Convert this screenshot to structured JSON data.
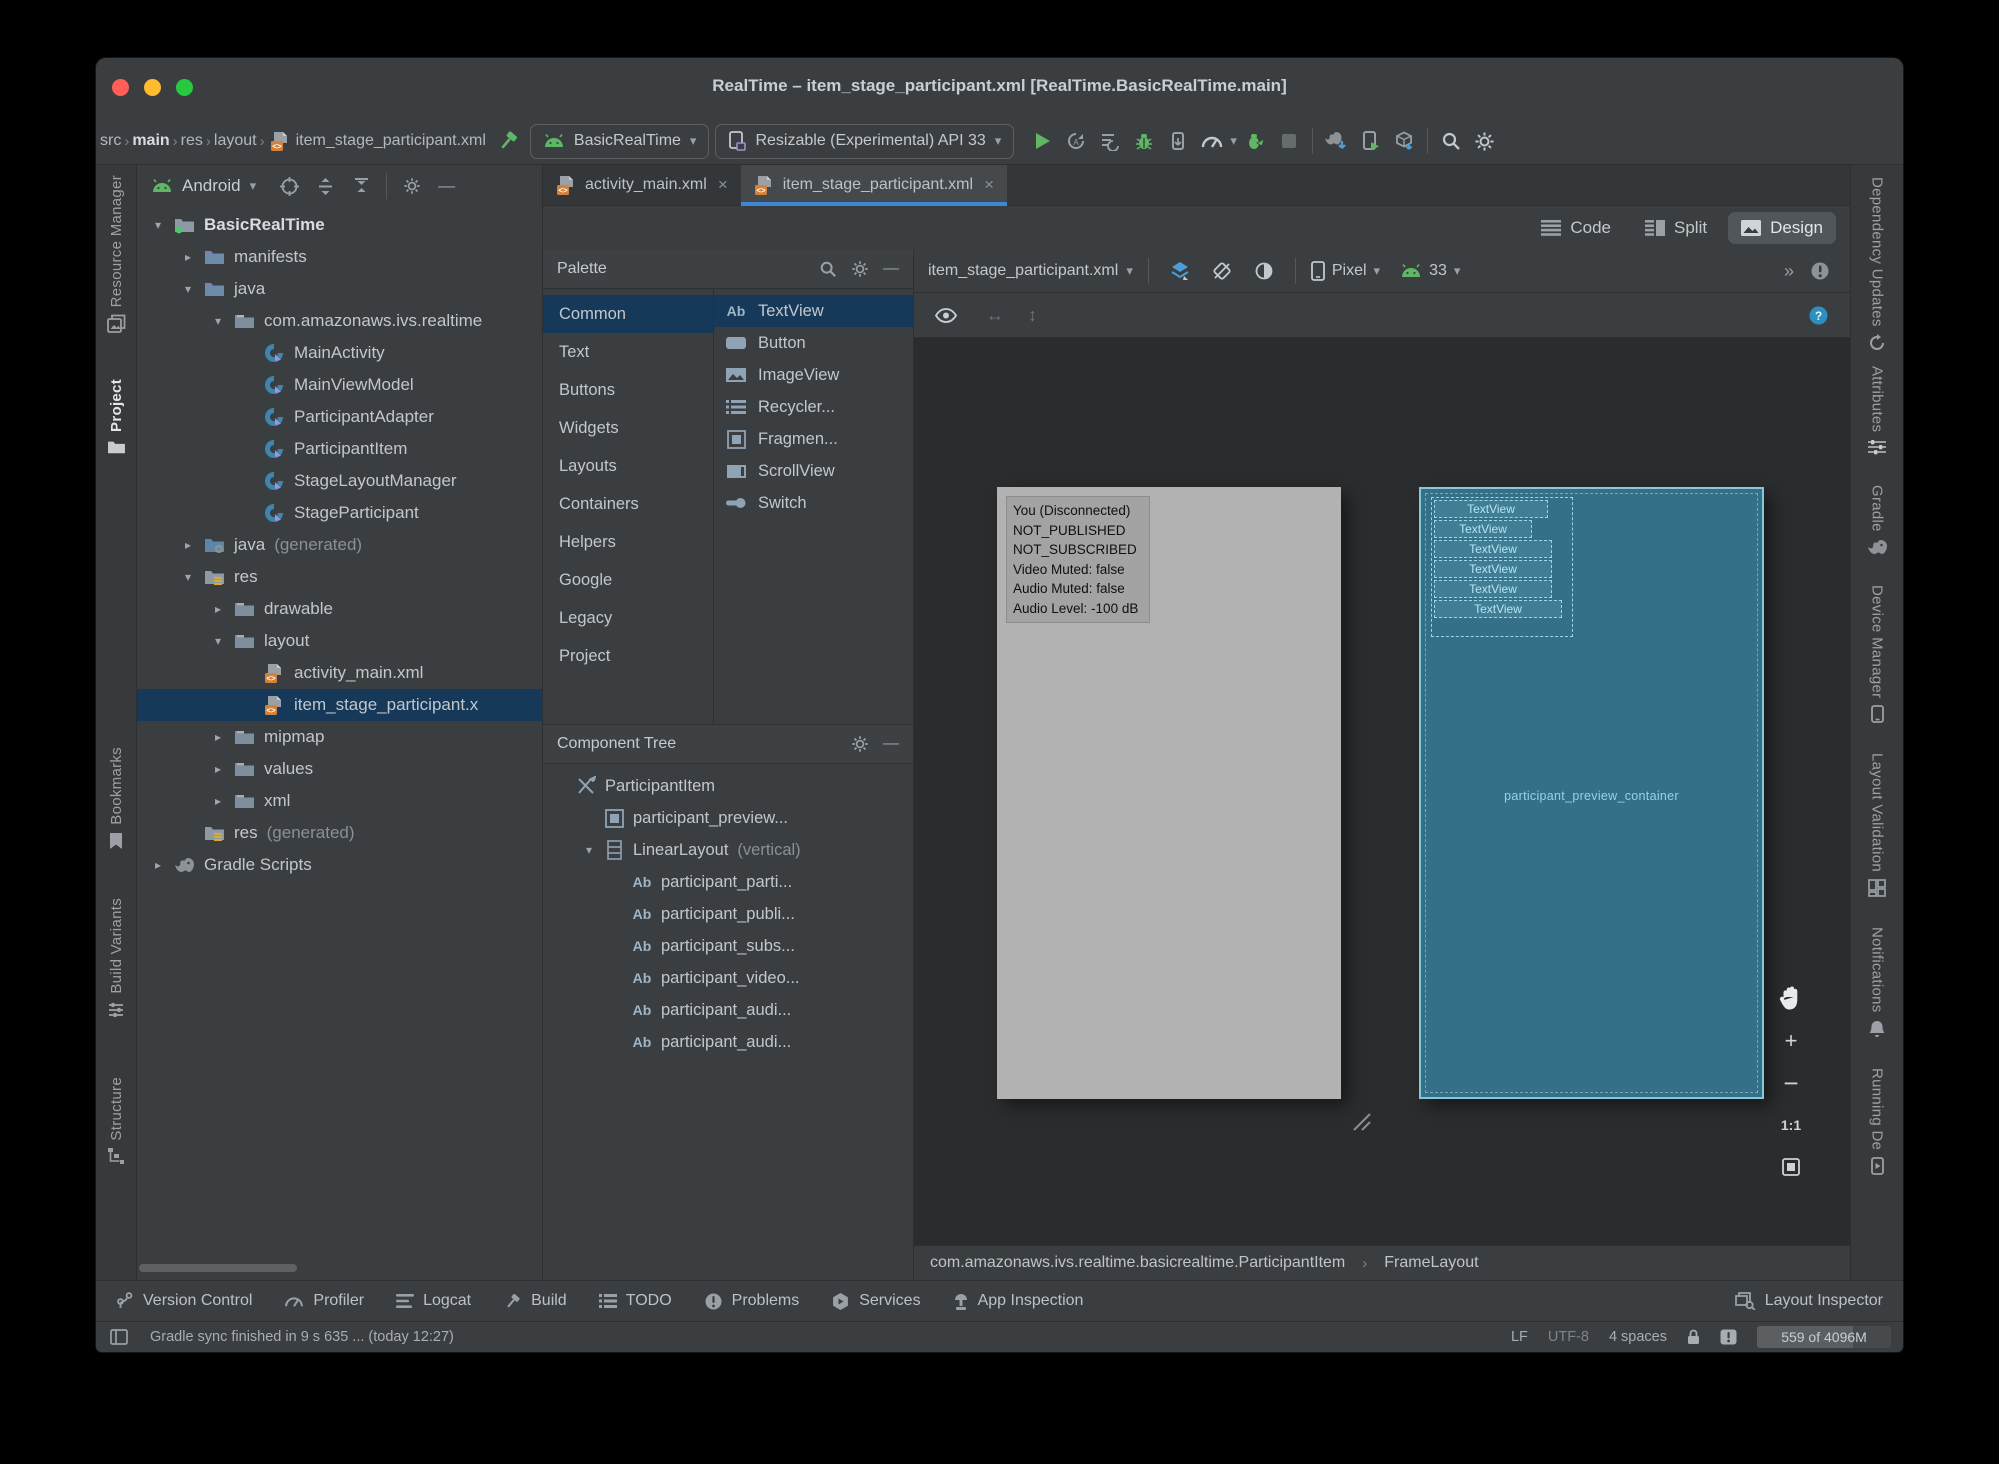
{
  "window": {
    "title": "RealTime – item_stage_participant.xml [RealTime.BasicRealTime.main]"
  },
  "toolbar": {
    "breadcrumbs": [
      "src",
      "main",
      "res",
      "layout",
      "item_stage_participant.xml"
    ],
    "run_config": "BasicRealTime",
    "device_select": "Resizable (Experimental) API 33",
    "actions": [
      "run",
      "apply-changes",
      "apply-code-changes",
      "debug",
      "attach-debugger",
      "profiler",
      "profile-app",
      "stop",
      "sync-gradle",
      "device-manager",
      "sdk-manager",
      "search-everywhere",
      "settings"
    ]
  },
  "stripes": {
    "left": [
      {
        "label": "Resource Manager",
        "icon": "resource-manager",
        "active": false
      },
      {
        "label": "Project",
        "icon": "project-folder",
        "active": true
      },
      {
        "label": "Bookmarks",
        "icon": "bookmark",
        "active": false
      },
      {
        "label": "Build Variants",
        "icon": "build-variants",
        "active": false
      },
      {
        "label": "Structure",
        "icon": "structure",
        "active": false
      }
    ],
    "right": [
      {
        "label": "Dependency Updates",
        "icon": "dependency-updates",
        "active": false
      },
      {
        "label": "Attributes",
        "icon": "attributes",
        "active": false
      },
      {
        "label": "Gradle",
        "icon": "gradle",
        "active": false
      },
      {
        "label": "Device Manager",
        "icon": "device-phone",
        "active": false
      },
      {
        "label": "Layout Validation",
        "icon": "layout-validation",
        "active": false
      },
      {
        "label": "Notifications",
        "icon": "notifications",
        "active": false
      },
      {
        "label": "Running De",
        "icon": "running-devices",
        "active": false
      }
    ]
  },
  "project": {
    "view_mode": "Android",
    "tree": [
      {
        "label": "BasicRealTime",
        "icon": "folder-root",
        "level": 0,
        "chevron": "down",
        "bold": true
      },
      {
        "label": "manifests",
        "icon": "folder-blue",
        "level": 1,
        "chevron": "right"
      },
      {
        "label": "java",
        "icon": "folder-blue",
        "level": 1,
        "chevron": "down"
      },
      {
        "label": "com.amazonaws.ivs.realtime",
        "icon": "folder-package",
        "level": 2,
        "chevron": "down"
      },
      {
        "label": "MainActivity",
        "icon": "class-kotlin",
        "level": 3
      },
      {
        "label": "MainViewModel",
        "icon": "class-kotlin",
        "level": 3
      },
      {
        "label": "ParticipantAdapter",
        "icon": "class-kotlin",
        "level": 3
      },
      {
        "label": "ParticipantItem",
        "icon": "class-kotlin",
        "level": 3
      },
      {
        "label": "StageLayoutManager",
        "icon": "class-kotlin",
        "level": 3
      },
      {
        "label": "StageParticipant",
        "icon": "class-kotlin",
        "level": 3
      },
      {
        "label": "java",
        "extra": "(generated)",
        "icon": "folder-generated",
        "level": 1,
        "chevron": "right"
      },
      {
        "label": "res",
        "icon": "folder-res",
        "level": 1,
        "chevron": "down"
      },
      {
        "label": "drawable",
        "icon": "folder-gray",
        "level": 2,
        "chevron": "right"
      },
      {
        "label": "layout",
        "icon": "folder-gray",
        "level": 2,
        "chevron": "down"
      },
      {
        "label": "activity_main.xml",
        "icon": "file-xml",
        "level": 3
      },
      {
        "label": "item_stage_participant.x",
        "icon": "file-xml",
        "level": 3,
        "selected": true
      },
      {
        "label": "mipmap",
        "icon": "folder-gray",
        "level": 2,
        "chevron": "right"
      },
      {
        "label": "values",
        "icon": "folder-gray",
        "level": 2,
        "chevron": "right"
      },
      {
        "label": "xml",
        "icon": "folder-gray",
        "level": 2,
        "chevron": "right"
      },
      {
        "label": "res",
        "extra": "(generated)",
        "icon": "folder-res",
        "level": 1
      },
      {
        "label": "Gradle Scripts",
        "icon": "gradle",
        "level": 0,
        "chevron": "right"
      }
    ]
  },
  "tabs": [
    {
      "label": "activity_main.xml",
      "icon": "file-xml",
      "active": false
    },
    {
      "label": "item_stage_participant.xml",
      "icon": "file-xml",
      "active": true
    }
  ],
  "editor_modes": {
    "code": "Code",
    "split": "Split",
    "design": "Design",
    "active": "Design"
  },
  "palette": {
    "title": "Palette",
    "categories": [
      "Common",
      "Text",
      "Buttons",
      "Widgets",
      "Layouts",
      "Containers",
      "Helpers",
      "Google",
      "Legacy",
      "Project"
    ],
    "selected_category": "Common",
    "items": [
      {
        "label": "TextView",
        "icon": "w-textview",
        "selected": true
      },
      {
        "label": "Button",
        "icon": "w-button",
        "selected": false
      },
      {
        "label": "ImageView",
        "icon": "w-imageview",
        "selected": false
      },
      {
        "label": "Recycler...",
        "icon": "w-recycler",
        "selected": false
      },
      {
        "label": "Fragmen...",
        "icon": "w-fragment",
        "selected": false
      },
      {
        "label": "ScrollView",
        "icon": "w-scrollview",
        "selected": false
      },
      {
        "label": "Switch",
        "icon": "w-switch",
        "selected": false
      }
    ]
  },
  "component_tree": {
    "title": "Component Tree",
    "rows": [
      {
        "label": "ParticipantItem",
        "icon": "custom-view",
        "level": 0
      },
      {
        "label": "participant_preview...",
        "icon": "w-fragment",
        "level": 1
      },
      {
        "label": "LinearLayout",
        "extra": "(vertical)",
        "icon": "linear-layout",
        "level": 1,
        "chevron": "down"
      },
      {
        "label": "participant_parti...",
        "icon": "w-textview",
        "level": 2
      },
      {
        "label": "participant_publi...",
        "icon": "w-textview",
        "level": 2
      },
      {
        "label": "participant_subs...",
        "icon": "w-textview",
        "level": 2
      },
      {
        "label": "participant_video...",
        "icon": "w-textview",
        "level": 2
      },
      {
        "label": "participant_audi...",
        "icon": "w-textview",
        "level": 2
      },
      {
        "label": "participant_audi...",
        "icon": "w-textview",
        "level": 2
      }
    ]
  },
  "design": {
    "file_dropdown": "item_stage_participant.xml",
    "device": "Pixel",
    "api": "33",
    "zoom_ratio": "1:1",
    "preview_info_lines": [
      "You (Disconnected)",
      "NOT_PUBLISHED",
      "NOT_SUBSCRIBED",
      "Video Muted: false",
      "Audio Muted: false",
      "Audio Level: -100 dB"
    ],
    "blueprint": {
      "textviews": [
        "TextView",
        "TextView",
        "TextView",
        "TextView",
        "TextView",
        "TextView"
      ],
      "container_label": "participant_preview_container"
    },
    "breadcrumb_class": "com.amazonaws.ivs.realtime.basicrealtime.ParticipantItem",
    "breadcrumb_layout": "FrameLayout"
  },
  "bottom_bar": {
    "left": [
      {
        "label": "Version Control",
        "icon": "vcs"
      },
      {
        "label": "Profiler",
        "icon": "gauge"
      },
      {
        "label": "Logcat",
        "icon": "logcat"
      },
      {
        "label": "Build",
        "icon": "hammer-gray"
      },
      {
        "label": "TODO",
        "icon": "todo"
      },
      {
        "label": "Problems",
        "icon": "problems"
      },
      {
        "label": "Services",
        "icon": "services"
      },
      {
        "label": "App Inspection",
        "icon": "inspection"
      }
    ],
    "right": [
      {
        "label": "Layout Inspector",
        "icon": "layout-inspector"
      }
    ]
  },
  "status_bar": {
    "message": "Gradle sync finished in 9 s 635 ... (today 12:27)",
    "line_ending": "LF",
    "encoding": "UTF-8",
    "indent": "4 spaces",
    "memory": "559 of 4096M"
  },
  "colors": {
    "traffic_red": "#ff5f57",
    "traffic_yellow": "#febc2e",
    "traffic_green": "#28c840",
    "accent_green": "#5fb765",
    "accent_blue": "#3f87d2",
    "selection": "#16395a",
    "blueprint_teal": "#366f88",
    "xml_orange": "#d2823a"
  }
}
